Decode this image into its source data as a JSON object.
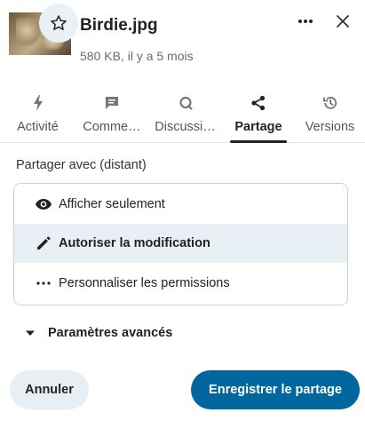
{
  "file": {
    "name": "Birdie.jpg",
    "meta": "580 KB, il y a 5 mois"
  },
  "tabs": [
    {
      "label": "Activité",
      "icon": "activity-bolt-icon",
      "active": false
    },
    {
      "label": "Comme…",
      "icon": "comment-icon",
      "active": false
    },
    {
      "label": "Discussi…",
      "icon": "talk-icon",
      "active": false
    },
    {
      "label": "Partage",
      "icon": "share-icon",
      "active": true
    },
    {
      "label": "Versions",
      "icon": "history-icon",
      "active": false
    }
  ],
  "share": {
    "with_label": "Partager avec (distant)",
    "permissions": [
      {
        "label": "Afficher seulement",
        "icon": "eye-icon",
        "selected": false
      },
      {
        "label": "Autoriser la modification",
        "icon": "pencil-icon",
        "selected": true
      },
      {
        "label": "Personnaliser les permissions",
        "icon": "dots-icon",
        "selected": false
      }
    ],
    "advanced_label": "Paramètres avancés"
  },
  "actions": {
    "cancel_label": "Annuler",
    "save_label": "Enregistrer le partage"
  },
  "colors": {
    "primary": "#00679e",
    "selected_bg": "#e8f0f5",
    "cancel_bg": "#e8eff4"
  }
}
